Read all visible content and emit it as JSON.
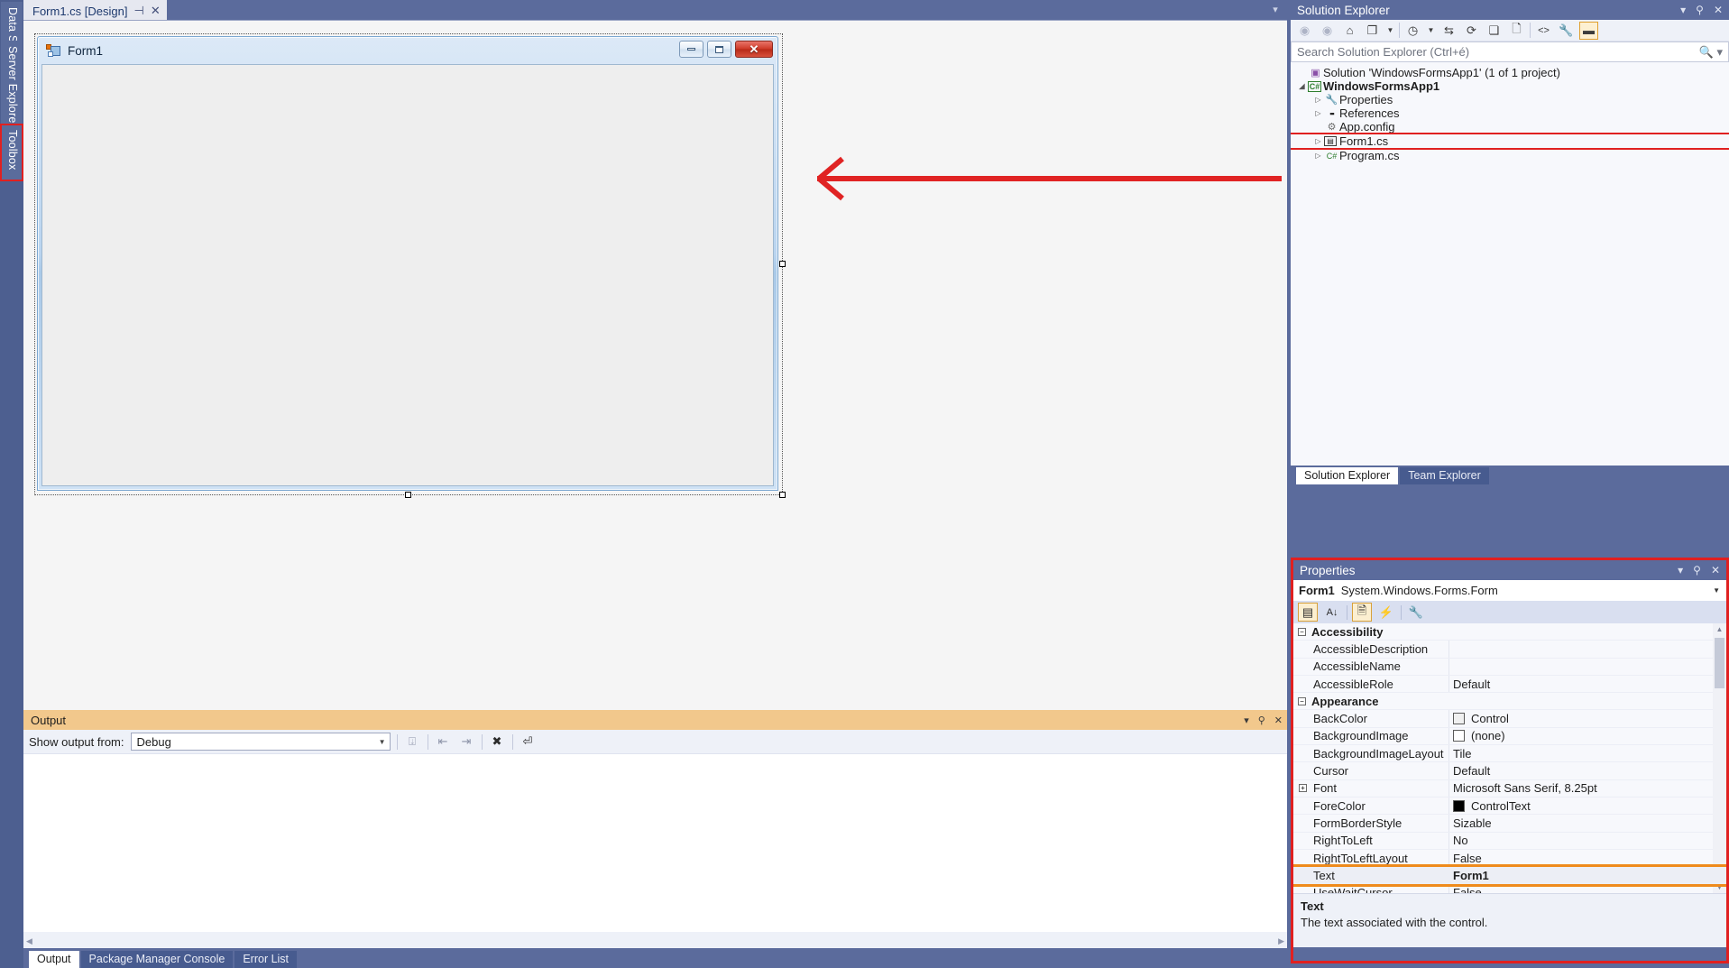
{
  "left_strip": {
    "tabs": [
      {
        "label": "Data Sources",
        "highlighted": false
      },
      {
        "label": "Server Explorer",
        "highlighted": false
      },
      {
        "label": "Toolbox",
        "highlighted": true
      }
    ]
  },
  "document_tabs": {
    "active": "Form1.cs [Design]",
    "pin_icon": "pin-icon",
    "close_icon": "close-icon",
    "overflow_icon": "chevron-down-icon"
  },
  "designer": {
    "form": {
      "title": "Form1",
      "app_icon": "windows-form-icon",
      "minimize_label": "Minimize",
      "maximize_label": "Maximize",
      "close_label": "✕"
    },
    "annotation": {
      "type": "arrow",
      "direction": "left",
      "color": "#e02323"
    }
  },
  "output_panel": {
    "title": "Output",
    "header_color": "#f2c88c",
    "show_output_from_label": "Show output from:",
    "selected_source": "Debug",
    "body_text": "",
    "tabs": [
      {
        "label": "Output",
        "active": true
      },
      {
        "label": "Package Manager Console",
        "active": false
      },
      {
        "label": "Error List",
        "active": false
      }
    ],
    "header_buttons": [
      {
        "name": "chevron-down-icon",
        "glyph": "▾"
      },
      {
        "name": "pin-icon",
        "glyph": "⚲"
      },
      {
        "name": "close-icon",
        "glyph": "✕"
      }
    ],
    "toolbar_icons": [
      "find-message-icon",
      "go-to-previous-icon",
      "go-to-next-icon",
      "clear-all-icon",
      "toggle-word-wrap-icon"
    ]
  },
  "solution_explorer": {
    "title": "Solution Explorer",
    "header_buttons": [
      {
        "name": "chevron-down-icon",
        "glyph": "▾"
      },
      {
        "name": "pin-icon",
        "glyph": "⚲"
      },
      {
        "name": "close-icon",
        "glyph": "✕"
      }
    ],
    "toolbar": [
      {
        "name": "back-icon",
        "glyph": "◀",
        "dim": true
      },
      {
        "name": "forward-icon",
        "glyph": "▶",
        "dim": true
      },
      {
        "name": "home-icon",
        "glyph": "⌂",
        "dim": false
      },
      {
        "name": "sync-with-active-document-icon",
        "glyph": "❐",
        "dim": false
      },
      {
        "name": "sync-dropdown-icon",
        "glyph": "▾",
        "dim": false
      },
      {
        "name": "pending-changes-filter-icon",
        "glyph": "◷",
        "dim": false
      },
      {
        "name": "filter-dropdown-icon",
        "glyph": "▾",
        "dim": false
      },
      {
        "name": "sync-views-icon",
        "glyph": "⇆",
        "dim": false
      },
      {
        "name": "refresh-icon",
        "glyph": "⟳",
        "dim": false
      },
      {
        "name": "collapse-all-icon",
        "glyph": "⊟",
        "dim": false
      },
      {
        "name": "show-all-files-icon",
        "glyph": "🗎",
        "dim": false
      },
      {
        "name": "view-code-icon",
        "glyph": "<>",
        "dim": false
      },
      {
        "name": "properties-icon",
        "glyph": "🔧",
        "dim": false
      },
      {
        "name": "preview-selected-items-icon",
        "glyph": "▬",
        "dim": false,
        "boxed": true
      }
    ],
    "search": {
      "placeholder": "Search Solution Explorer (Ctrl+é)",
      "value": "",
      "icon": "search-icon",
      "dropdown_icon": "chevron-down-icon"
    },
    "tree": [
      {
        "indent": 0,
        "expander": "",
        "icon": "solution-icon",
        "glyph": "▣",
        "color": "#8a4fa8",
        "label": "Solution 'WindowsFormsApp1' (1 of 1 project)",
        "bold": false,
        "highlighted": false
      },
      {
        "indent": 1,
        "expander": "▲",
        "icon": "csharp-project-icon",
        "glyph": "C#",
        "color": "#2d7d2d",
        "label": "WindowsFormsApp1",
        "bold": true,
        "highlighted": false
      },
      {
        "indent": 2,
        "expander": "▷",
        "icon": "properties-folder-icon",
        "glyph": "🔧",
        "color": "#4b4b4b",
        "label": "Properties",
        "bold": false,
        "highlighted": false
      },
      {
        "indent": 2,
        "expander": "▷",
        "icon": "references-icon",
        "glyph": "▪▪",
        "color": "#4b4b4b",
        "label": "References",
        "bold": false,
        "highlighted": false
      },
      {
        "indent": 2,
        "expander": "",
        "icon": "config-file-icon",
        "glyph": "⚙",
        "color": "#6f6f6f",
        "label": "App.config",
        "bold": false,
        "highlighted": false
      },
      {
        "indent": 2,
        "expander": "▷",
        "icon": "form-file-icon",
        "glyph": "▤",
        "color": "#3b3b3b",
        "label": "Form1.cs",
        "bold": false,
        "highlighted": true
      },
      {
        "indent": 2,
        "expander": "▷",
        "icon": "csharp-file-icon",
        "glyph": "C#",
        "color": "#2d7d2d",
        "label": "Program.cs",
        "bold": false,
        "highlighted": false
      }
    ],
    "tabs": [
      {
        "label": "Solution Explorer",
        "active": true
      },
      {
        "label": "Team Explorer",
        "active": false
      }
    ]
  },
  "properties": {
    "title": "Properties",
    "highlight_color": "#e02020",
    "header_buttons": [
      {
        "name": "chevron-down-icon",
        "glyph": "▾"
      },
      {
        "name": "pin-icon",
        "glyph": "⚲"
      },
      {
        "name": "close-icon",
        "glyph": "✕"
      }
    ],
    "object_name": "Form1",
    "object_type": "System.Windows.Forms.Form",
    "object_dropdown_icon": "chevron-down-icon",
    "toolbar": [
      {
        "name": "categorized-icon",
        "glyph": "▦",
        "boxed": true,
        "dim": false
      },
      {
        "name": "alphabetical-sort-icon",
        "glyph": "A↓",
        "boxed": false,
        "dim": false
      },
      {
        "name": "properties-view-icon",
        "glyph": "🗎",
        "boxed": true,
        "dim": false
      },
      {
        "name": "events-view-icon",
        "glyph": "⚡",
        "boxed": false,
        "dim": false
      },
      {
        "name": "property-pages-icon",
        "glyph": "🔧",
        "boxed": false,
        "dim": true
      }
    ],
    "rows": [
      {
        "kind": "category",
        "name": "Accessibility",
        "value": "",
        "expander": "−"
      },
      {
        "kind": "prop",
        "name": "AccessibleDescription",
        "value": ""
      },
      {
        "kind": "prop",
        "name": "AccessibleName",
        "value": ""
      },
      {
        "kind": "prop",
        "name": "AccessibleRole",
        "value": "Default"
      },
      {
        "kind": "category",
        "name": "Appearance",
        "value": "",
        "expander": "−"
      },
      {
        "kind": "prop",
        "name": "BackColor",
        "value": "Control",
        "swatch": "#f0f0f0"
      },
      {
        "kind": "prop",
        "name": "BackgroundImage",
        "value": "(none)",
        "swatch": "#ffffff"
      },
      {
        "kind": "prop",
        "name": "BackgroundImageLayout",
        "value": "Tile"
      },
      {
        "kind": "prop",
        "name": "Cursor",
        "value": "Default"
      },
      {
        "kind": "prop",
        "name": "Font",
        "value": "Microsoft Sans Serif, 8.25pt",
        "expander": "+"
      },
      {
        "kind": "prop",
        "name": "ForeColor",
        "value": "ControlText",
        "swatch": "#000000"
      },
      {
        "kind": "prop",
        "name": "FormBorderStyle",
        "value": "Sizable"
      },
      {
        "kind": "prop",
        "name": "RightToLeft",
        "value": "No"
      },
      {
        "kind": "prop",
        "name": "RightToLeftLayout",
        "value": "False"
      },
      {
        "kind": "prop",
        "name": "Text",
        "value": "Form1",
        "selected": true
      },
      {
        "kind": "prop",
        "name": "UseWaitCursor",
        "value": "False"
      }
    ],
    "help": {
      "title": "Text",
      "description": "The text associated with the control."
    }
  }
}
